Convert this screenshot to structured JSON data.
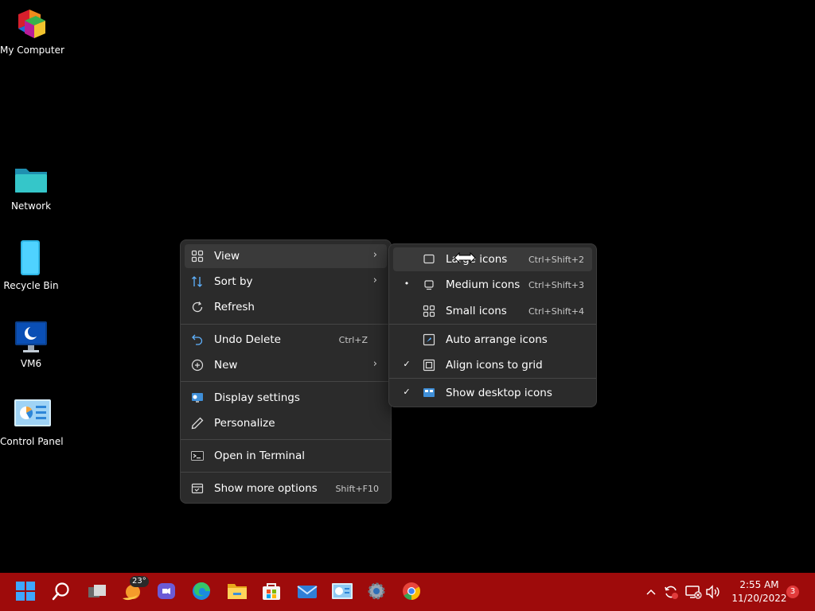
{
  "desktop": {
    "icons": [
      {
        "label": "My Computer",
        "icon": "package-blocks-icon"
      },
      {
        "label": "Network",
        "icon": "folder-icon"
      },
      {
        "label": "Recycle Bin",
        "icon": "recycle-bin-icon"
      },
      {
        "label": "VM6",
        "icon": "monitor-icon"
      },
      {
        "label": "Control Panel",
        "icon": "control-panel-icon"
      }
    ]
  },
  "context_menu": {
    "items": [
      {
        "label": "View",
        "icon": "grid-icon",
        "submenu": true
      },
      {
        "label": "Sort by",
        "icon": "sort-icon",
        "submenu": true
      },
      {
        "label": "Refresh",
        "icon": "refresh-icon"
      },
      {
        "label": "Undo Delete",
        "icon": "undo-icon",
        "shortcut": "Ctrl+Z"
      },
      {
        "label": "New",
        "icon": "plus-circle-icon",
        "submenu": true
      },
      {
        "label": "Display settings",
        "icon": "display-settings-icon"
      },
      {
        "label": "Personalize",
        "icon": "pen-icon"
      },
      {
        "label": "Open in Terminal",
        "icon": "terminal-icon"
      },
      {
        "label": "Show more options",
        "icon": "more-options-icon",
        "shortcut": "Shift+F10"
      }
    ]
  },
  "view_submenu": {
    "items": [
      {
        "label": "Large icons",
        "shortcut": "Ctrl+Shift+2",
        "mark": "",
        "icon": "large-icons-icon"
      },
      {
        "label": "Medium icons",
        "shortcut": "Ctrl+Shift+3",
        "mark": "•",
        "icon": "medium-icons-icon"
      },
      {
        "label": "Small icons",
        "shortcut": "Ctrl+Shift+4",
        "mark": "",
        "icon": "small-icons-icon"
      },
      {
        "label": "Auto arrange icons",
        "mark": "",
        "icon": "auto-arrange-icon"
      },
      {
        "label": "Align icons to grid",
        "mark": "✓",
        "icon": "align-grid-icon"
      },
      {
        "label": "Show desktop icons",
        "mark": "✓",
        "icon": "show-desktop-icon"
      }
    ]
  },
  "taskbar": {
    "weather_temp": "23°",
    "time": "2:55 AM",
    "date": "11/20/2022",
    "notification_count": "3",
    "colors": {
      "bar": "#9e0b0b",
      "accent": "#2d8fe3"
    }
  }
}
